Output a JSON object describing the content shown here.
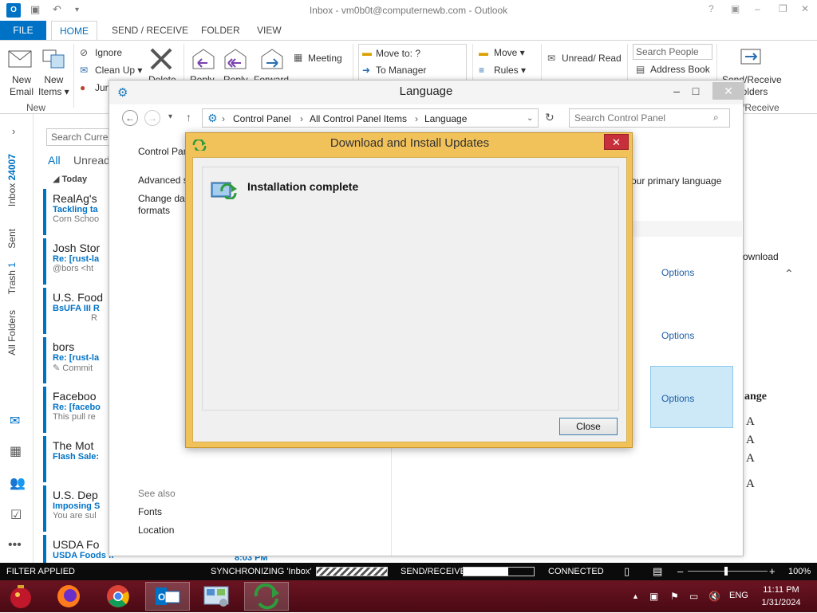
{
  "outlook": {
    "title": "Inbox - vm0b0t@computernewb.com - Outlook",
    "app_icon": "O",
    "tabs": [
      "FILE",
      "HOME",
      "SEND / RECEIVE",
      "FOLDER",
      "VIEW"
    ],
    "ribbon": {
      "new_email": [
        "New",
        "Email"
      ],
      "new_items": [
        "New",
        "Items ▾"
      ],
      "group_new": "New",
      "ignore": "Ignore",
      "clean_up": "Clean Up ▾",
      "junk": "Jun",
      "delete": "Delete",
      "reply": "Reply",
      "reply_all": "Reply",
      "forward": "Forward",
      "meeting": "Meeting",
      "move_to": "Move to: ?",
      "to_manager": "To Manager",
      "move": "Move ▾",
      "rules": "Rules ▾",
      "unread_read": "Unread/ Read",
      "search_people": "Search People",
      "address_book": "Address Book",
      "send_receive": [
        "Send/Receive",
        "Folders"
      ],
      "send_receive_group": "/Receive"
    },
    "nav": {
      "inbox": "Inbox",
      "inbox_count": "24007",
      "sent": "Sent",
      "trash": "Trash",
      "trash_count": "1",
      "all_folders": "All Folders"
    },
    "search_placeholder": "Search Curren",
    "filter_all": "All",
    "filter_unread": "Unread",
    "group_today": "Today",
    "mails": [
      {
        "sender": "RealAg's",
        "subject": "Tackling ta",
        "preview": "Corn Schoo"
      },
      {
        "sender": "Josh Stor",
        "subject": "Re: [rust-la",
        "preview": "@bors <ht"
      },
      {
        "sender": "U.S. Food",
        "subject": "BsUFA III R",
        "preview": "R"
      },
      {
        "sender": "bors",
        "subject": "Re: [rust-la",
        "preview": "Commit"
      },
      {
        "sender": "Faceboo",
        "subject": "Re: [facebo",
        "preview": "This pull re"
      },
      {
        "sender": "The Mot",
        "subject": "Flash Sale:",
        "preview": ""
      },
      {
        "sender": "U.S. Dep",
        "subject": "Imposing S",
        "preview": "You are sul"
      },
      {
        "sender": "USDA Fo",
        "subject": "USDA Foods from Farm to Plate:",
        "preview": "",
        "time": "8:03 PM"
      }
    ],
    "status": {
      "filter": "FILTER APPLIED",
      "sync": "SYNCHRONIZING  'Inbox'",
      "sendrecv": "SEND/RECEIVE",
      "connected": "CONNECTED",
      "zoom": "100%"
    }
  },
  "language_window": {
    "title": "Language",
    "breadcrumb": [
      "Control Panel",
      "All Control Panel Items",
      "Language"
    ],
    "search_placeholder": "Search Control Panel",
    "sidebar": [
      "Control Pan",
      "Advanced s",
      "Change dat",
      "formats"
    ],
    "see_also": "See also",
    "see_also_links": [
      "Fonts",
      "Location"
    ],
    "right_text": "our primary language",
    "download_text": "ownload",
    "options": [
      "Options",
      "Options",
      "Options"
    ],
    "change_text": "ange",
    "letters": [
      "A",
      "A",
      "A",
      "A"
    ]
  },
  "dialog": {
    "title": "Download and Install Updates",
    "heading": "Installation complete",
    "close_button": "Close"
  },
  "taskbar": {
    "time": "11:11 PM",
    "date": "1/31/2024",
    "lang": "ENG"
  }
}
